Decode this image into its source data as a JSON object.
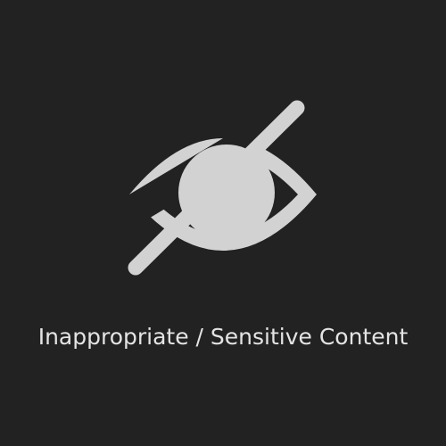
{
  "placeholder": {
    "message": "Inappropriate / Sensitive Content",
    "icon": "eye-slash-icon",
    "colors": {
      "background": "#222222",
      "icon": "#d2d2d2",
      "text": "#e4e4e4"
    }
  }
}
